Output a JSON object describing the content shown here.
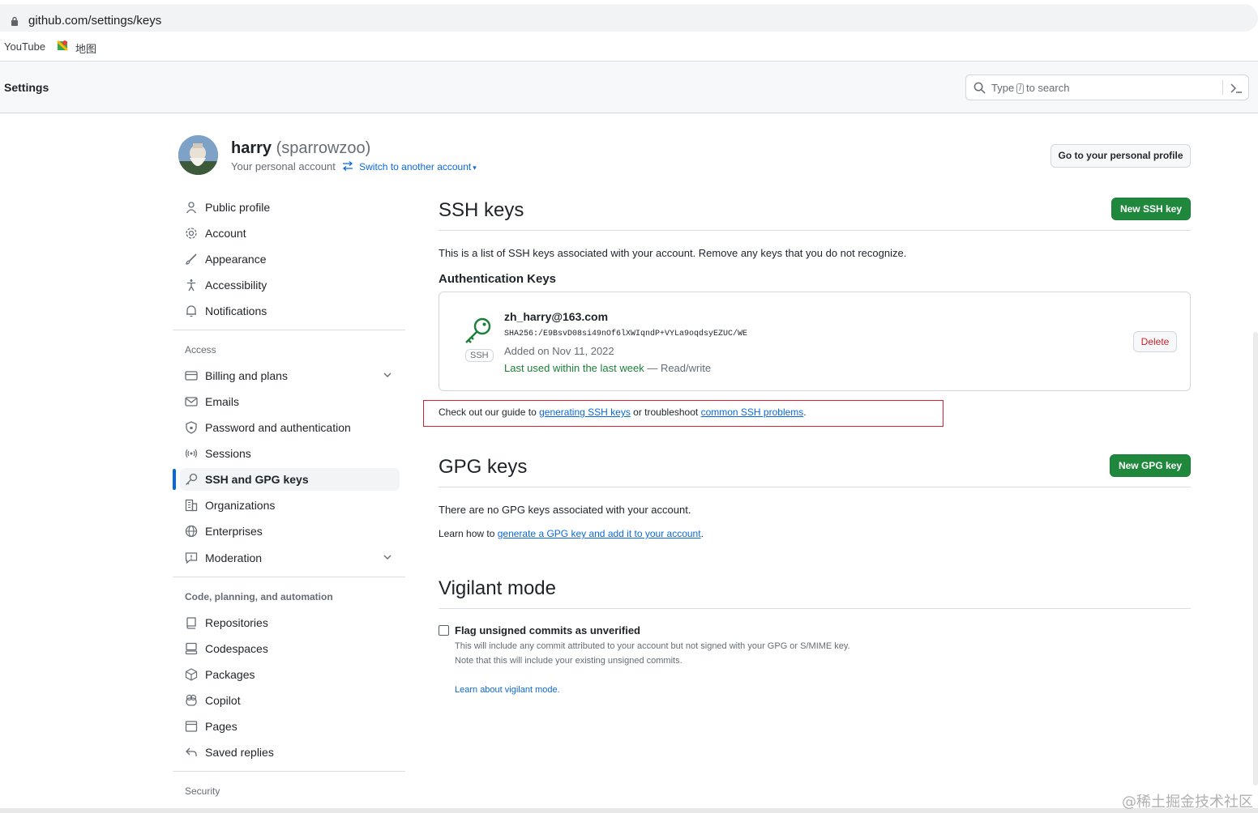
{
  "browser": {
    "url": "github.com/settings/keys",
    "bookmarks": [
      "YouTube",
      "地图"
    ]
  },
  "header": {
    "title": "Settings",
    "search_prefix": "Type",
    "search_key": "/",
    "search_suffix": "to search"
  },
  "account": {
    "name": "harry",
    "handle": "(sparrowzoo)",
    "subtitle": "Your personal account",
    "switch_label": "Switch to another account",
    "profile_button": "Go to your personal profile"
  },
  "sidebar": {
    "items_top": [
      {
        "label": "Public profile",
        "icon": "person-icon"
      },
      {
        "label": "Account",
        "icon": "gear-icon"
      },
      {
        "label": "Appearance",
        "icon": "paintbrush-icon"
      },
      {
        "label": "Accessibility",
        "icon": "accessibility-icon"
      },
      {
        "label": "Notifications",
        "icon": "bell-icon"
      }
    ],
    "group_access": "Access",
    "items_access": [
      {
        "label": "Billing and plans",
        "icon": "credit-card-icon"
      },
      {
        "label": "Emails",
        "icon": "mail-icon"
      },
      {
        "label": "Password and authentication",
        "icon": "shield-lock-icon"
      },
      {
        "label": "Sessions",
        "icon": "broadcast-icon"
      },
      {
        "label": "SSH and GPG keys",
        "icon": "key-icon"
      },
      {
        "label": "Organizations",
        "icon": "organization-icon"
      },
      {
        "label": "Enterprises",
        "icon": "globe-icon"
      },
      {
        "label": "Moderation",
        "icon": "report-icon"
      }
    ],
    "group_code": "Code, planning, and automation",
    "items_code": [
      {
        "label": "Repositories",
        "icon": "repo-icon"
      },
      {
        "label": "Codespaces",
        "icon": "codespaces-icon"
      },
      {
        "label": "Packages",
        "icon": "package-icon"
      },
      {
        "label": "Copilot",
        "icon": "copilot-icon"
      },
      {
        "label": "Pages",
        "icon": "browser-icon"
      },
      {
        "label": "Saved replies",
        "icon": "reply-icon"
      }
    ],
    "group_security": "Security"
  },
  "ssh": {
    "title": "SSH keys",
    "new_button": "New SSH key",
    "description": "This is a list of SSH keys associated with your account. Remove any keys that you do not recognize.",
    "auth_heading": "Authentication Keys",
    "key": {
      "badge": "SSH",
      "title": "zh_harry@163.com",
      "fingerprint": "SHA256:/E9BsvD08si49nOf6lXWIqndP+VYLa9oqdsyEZUC/WE",
      "added": "Added on Nov 11, 2022",
      "last_used": "Last used within the last week",
      "access": " — Read/write",
      "delete_button": "Delete"
    },
    "guide_prefix": "Check out our guide to",
    "guide_link1": "generating SSH keys",
    "guide_middle": "or troubleshoot",
    "guide_link2": "common SSH problems",
    "guide_suffix": "."
  },
  "gpg": {
    "title": "GPG keys",
    "new_button": "New GPG key",
    "description": "There are no GPG keys associated with your account.",
    "learn_prefix": "Learn how to",
    "learn_link": "generate a GPG key and add it to your account",
    "learn_suffix": "."
  },
  "vigilant": {
    "title": "Vigilant mode",
    "checkbox_label": "Flag unsigned commits as unverified",
    "note1": "This will include any commit attributed to your account but not signed with your GPG or S/MIME key.",
    "note2": "Note that this will include your existing unsigned commits.",
    "learn_link": "Learn about vigilant mode."
  },
  "watermark": "@稀土掘金技术社区",
  "colors": {
    "accent": "#0969da",
    "primary_button": "#1f883d",
    "danger": "#cf222e",
    "highlight_box": "#d1242f"
  }
}
